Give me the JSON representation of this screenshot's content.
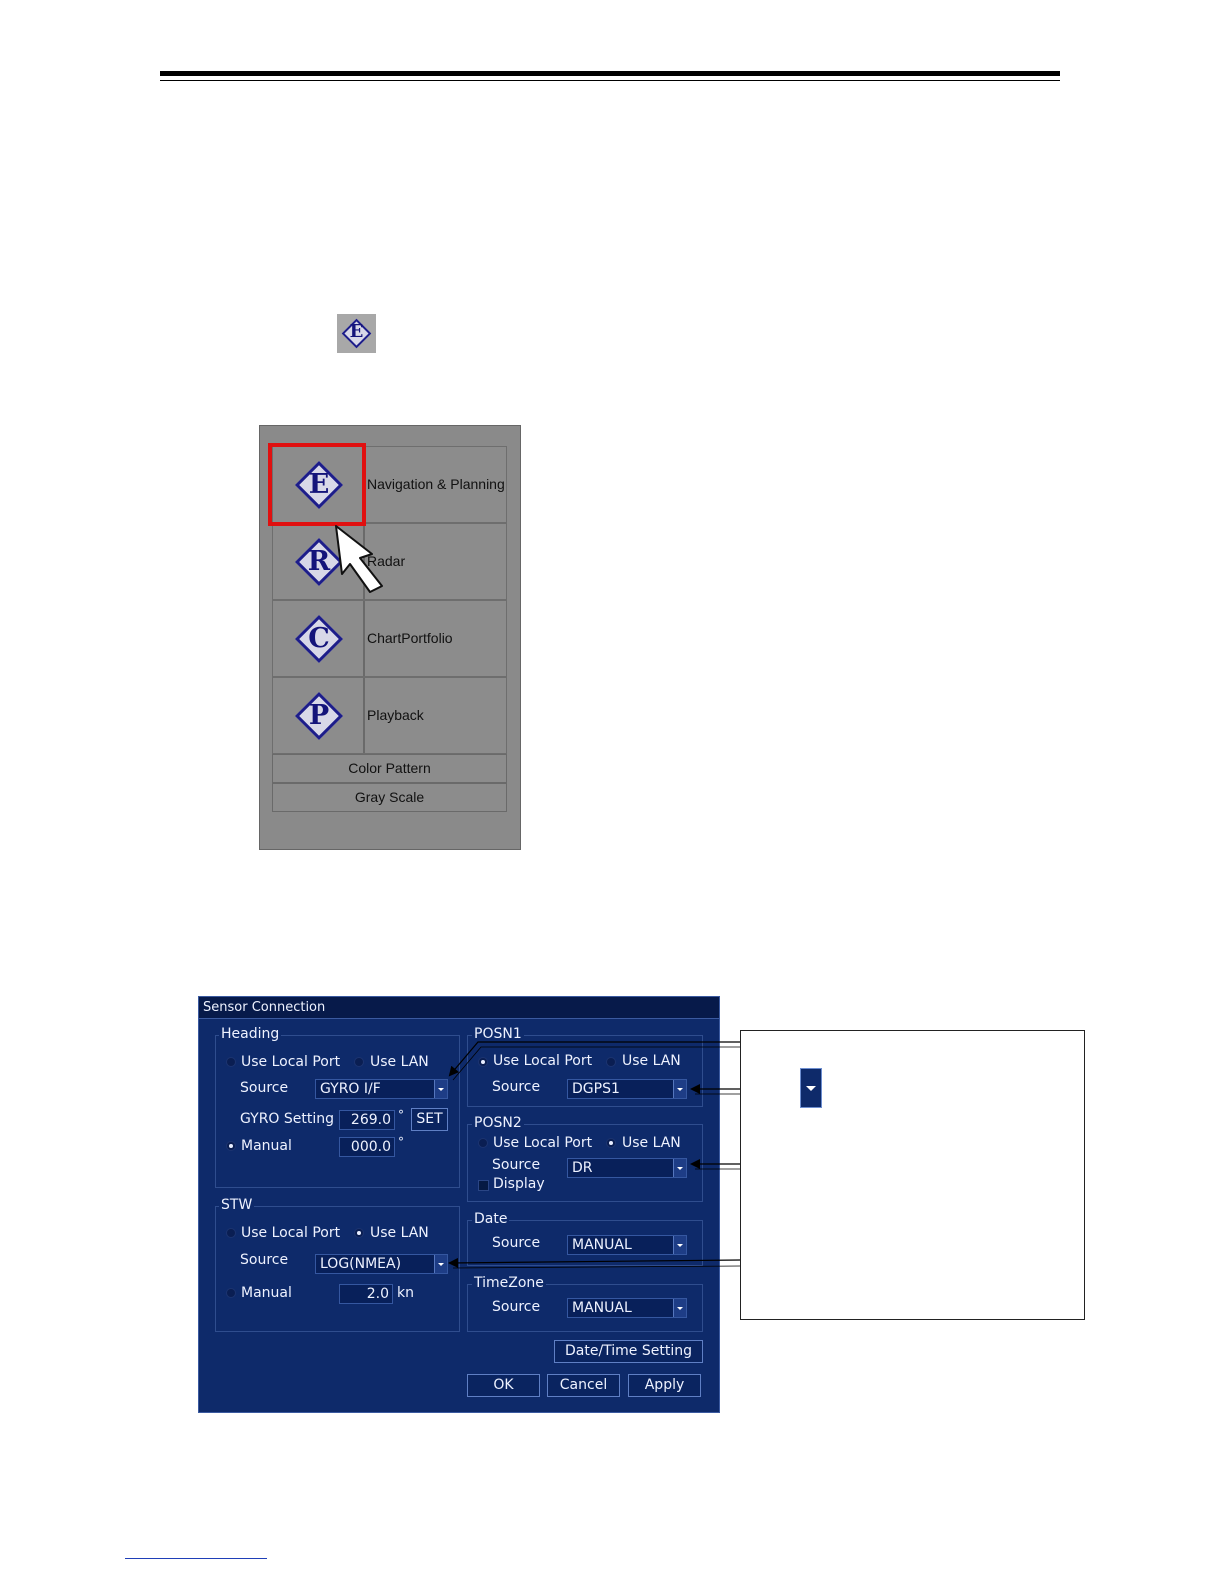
{
  "mode_menu": {
    "items": [
      {
        "letter": "E",
        "label": "Navigation & Planning"
      },
      {
        "letter": "R",
        "label": "Radar"
      },
      {
        "letter": "C",
        "label": "ChartPortfolio"
      },
      {
        "letter": "P",
        "label": "Playback"
      }
    ],
    "color_pattern_label": "Color Pattern",
    "gray_scale_label": "Gray Scale"
  },
  "inline_icon_letter": "E",
  "dialog": {
    "title": "Sensor Connection",
    "heading": {
      "title": "Heading",
      "use_local_port": "Use Local Port",
      "use_lan": "Use LAN",
      "source_label": "Source",
      "source_value": "GYRO I/F",
      "gyro_setting_label": "GYRO Setting",
      "gyro_value": "269.0",
      "degree": "°",
      "set_button": "SET",
      "manual_label": "Manual",
      "manual_value": "000.0"
    },
    "stw": {
      "title": "STW",
      "use_local_port": "Use Local Port",
      "use_lan": "Use LAN",
      "source_label": "Source",
      "source_value": "LOG(NMEA)",
      "manual_label": "Manual",
      "manual_value": "2.0",
      "unit": "kn"
    },
    "posn1": {
      "title": "POSN1",
      "use_local_port": "Use Local Port",
      "use_lan": "Use LAN",
      "source_label": "Source",
      "source_value": "DGPS1"
    },
    "posn2": {
      "title": "POSN2",
      "use_local_port": "Use Local Port",
      "use_lan": "Use LAN",
      "source_label": "Source",
      "source_value": "DR",
      "display_label": "Display"
    },
    "date": {
      "title": "Date",
      "source_label": "Source",
      "source_value": "MANUAL"
    },
    "timezone": {
      "title": "TimeZone",
      "source_label": "Source",
      "source_value": "MANUAL"
    },
    "datetime_button": "Date/Time Setting",
    "ok_button": "OK",
    "cancel_button": "Cancel",
    "apply_button": "Apply"
  }
}
